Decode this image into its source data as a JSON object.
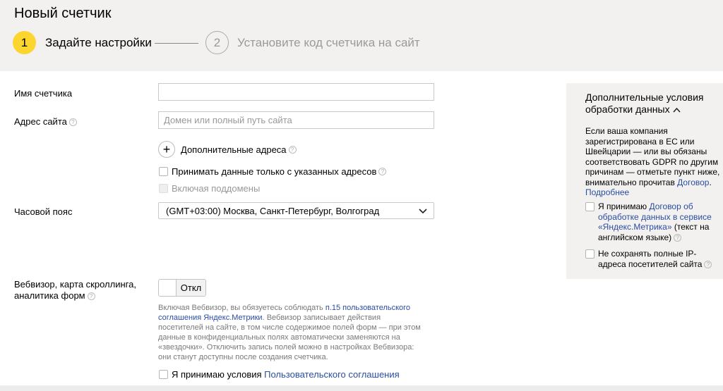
{
  "page": {
    "title": "Новый счетчик"
  },
  "steps": [
    {
      "number": "1",
      "label": "Задайте настройки"
    },
    {
      "number": "2",
      "label": "Установите код счетчика на сайт"
    }
  ],
  "form": {
    "counter_name_label": "Имя счетчика",
    "counter_name_value": "",
    "site_address_label": "Адрес сайта",
    "site_address_placeholder": "Домен или полный путь сайта",
    "additional_addresses_label": "Дополнительные адреса",
    "only_specified_label": "Принимать данные только с указанных адресов",
    "include_subdomains_label": "Включая поддомены",
    "timezone_label": "Часовой пояс",
    "timezone_value": "(GMT+03:00) Москва, Санкт-Петербург, Волгоград",
    "webvisor_label_line1": "Вебвизор, карта скроллинга,",
    "webvisor_label_line2": "аналитика форм",
    "toggle_label": "Откл",
    "hint_part1": "Включая Вебвизор, вы обязуетесь соблюдать ",
    "hint_link": "п.15 пользовательского соглашения Яндекс.Метрики",
    "hint_part2": ". Вебвизор записывает действия посетителей на сайте, в том числе содержимое полей форм — при этом данные в конфиденциальных полях автоматически заменяются на «звездочки». Отключить запись полей можно в настройках Вебвизора: они станут доступны после создания счетчика.",
    "accept_terms_text": "Я принимаю условия ",
    "accept_terms_link": "Пользовательского соглашения"
  },
  "side_panel": {
    "title": "Дополнительные условия обработки данных",
    "text_part1": "Если ваша компания зарегистрирована в ЕС или Швейцарии — или вы обязаны соответствовать GDPR по другим причинам — отметьте пункт ниже, внимательно прочитав ",
    "text_link1": "Договор",
    "text_part2": ".",
    "text_link2": "Подробнее",
    "accept_text": "Я принимаю ",
    "accept_link": "Договор об обработке данных в сервисе «Яндекс.Метрика»",
    "accept_suffix": " (текст на английском языке)",
    "no_ip_text": "Не сохранять полные IP-адреса посетителей сайта"
  },
  "icons": {
    "help": "question-icon",
    "plus": "plus-icon",
    "dropdown": "chevron-down-icon",
    "collapse": "chevron-up-icon"
  },
  "colors": {
    "accent": "#fcd52e",
    "link": "#2a4da3",
    "header_bg": "#f2f1ef"
  }
}
